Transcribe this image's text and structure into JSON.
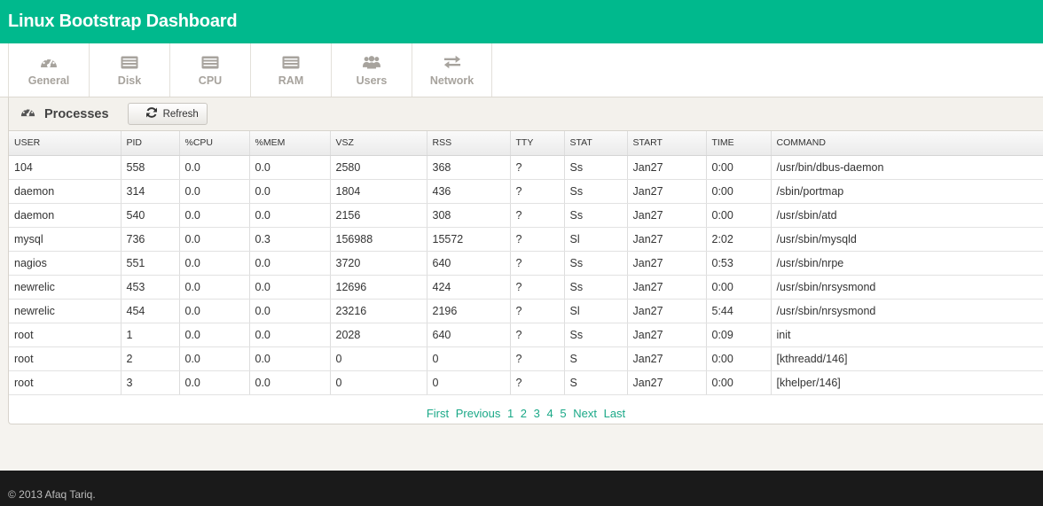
{
  "header": {
    "title": "Linux Bootstrap Dashboard"
  },
  "nav": [
    {
      "label": "General",
      "icon": "dashboard-icon"
    },
    {
      "label": "Disk",
      "icon": "list-icon"
    },
    {
      "label": "CPU",
      "icon": "list-icon"
    },
    {
      "label": "RAM",
      "icon": "list-icon"
    },
    {
      "label": "Users",
      "icon": "users-icon"
    },
    {
      "label": "Network",
      "icon": "exchange-icon"
    }
  ],
  "processes": {
    "title": "Processes",
    "refresh_label": "Refresh",
    "columns": [
      "USER",
      "PID",
      "%CPU",
      "%MEM",
      "VSZ",
      "RSS",
      "TTY",
      "STAT",
      "START",
      "TIME",
      "COMMAND"
    ],
    "rows": [
      [
        "104",
        "558",
        "0.0",
        "0.0",
        "2580",
        "368",
        "?",
        "Ss",
        "Jan27",
        "0:00",
        "/usr/bin/dbus-daemon"
      ],
      [
        "daemon",
        "314",
        "0.0",
        "0.0",
        "1804",
        "436",
        "?",
        "Ss",
        "Jan27",
        "0:00",
        "/sbin/portmap"
      ],
      [
        "daemon",
        "540",
        "0.0",
        "0.0",
        "2156",
        "308",
        "?",
        "Ss",
        "Jan27",
        "0:00",
        "/usr/sbin/atd"
      ],
      [
        "mysql",
        "736",
        "0.0",
        "0.3",
        "156988",
        "15572",
        "?",
        "Sl",
        "Jan27",
        "2:02",
        "/usr/sbin/mysqld"
      ],
      [
        "nagios",
        "551",
        "0.0",
        "0.0",
        "3720",
        "640",
        "?",
        "Ss",
        "Jan27",
        "0:53",
        "/usr/sbin/nrpe"
      ],
      [
        "newrelic",
        "453",
        "0.0",
        "0.0",
        "12696",
        "424",
        "?",
        "Ss",
        "Jan27",
        "0:00",
        "/usr/sbin/nrsysmond"
      ],
      [
        "newrelic",
        "454",
        "0.0",
        "0.0",
        "23216",
        "2196",
        "?",
        "Sl",
        "Jan27",
        "5:44",
        "/usr/sbin/nrsysmond"
      ],
      [
        "root",
        "1",
        "0.0",
        "0.0",
        "2028",
        "640",
        "?",
        "Ss",
        "Jan27",
        "0:09",
        "init"
      ],
      [
        "root",
        "2",
        "0.0",
        "0.0",
        "0",
        "0",
        "?",
        "S",
        "Jan27",
        "0:00",
        "[kthreadd/146]"
      ],
      [
        "root",
        "3",
        "0.0",
        "0.0",
        "0",
        "0",
        "?",
        "S",
        "Jan27",
        "0:00",
        "[khelper/146]"
      ]
    ]
  },
  "pagination": {
    "first": "First",
    "previous": "Previous",
    "pages": [
      "1",
      "2",
      "3",
      "4",
      "5"
    ],
    "next": "Next",
    "last": "Last"
  },
  "footer": {
    "text": "© 2013 Afaq Tariq."
  },
  "colors": {
    "brand": "#00b98d",
    "link": "#1aa887",
    "footer_bg": "#1a1a1a"
  }
}
